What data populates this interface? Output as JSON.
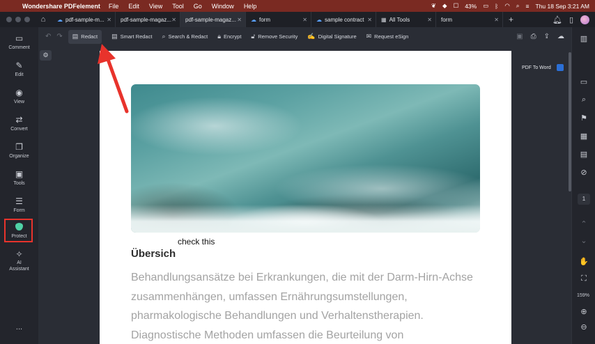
{
  "menubar": {
    "app_name": "Wondershare PDFelement",
    "items": [
      "File",
      "Edit",
      "View",
      "Tool",
      "Go",
      "Window",
      "Help"
    ],
    "battery": "43%",
    "clock": "Thu 18 Sep  3:21 AM"
  },
  "tabs": [
    {
      "label": "pdf-sample-m...",
      "cloud": true
    },
    {
      "label": "pdf-sample-magaz...",
      "cloud": false
    },
    {
      "label": "pdf-sample-magaz...",
      "cloud": false
    },
    {
      "label": "form",
      "cloud": true
    },
    {
      "label": "sample contract",
      "cloud": true
    },
    {
      "label": "All Tools",
      "cloud": false
    },
    {
      "label": "form",
      "cloud": false
    }
  ],
  "sidebar": {
    "items": [
      "Comment",
      "Edit",
      "View",
      "Convert",
      "Organize",
      "Tools",
      "Form",
      "Protect",
      "AI\nAssistant"
    ],
    "more": "..."
  },
  "toolbar": {
    "redact": "Redact",
    "smart_redact": "Smart Redact",
    "search_redact": "Search & Redact",
    "encrypt": "Encrypt",
    "remove_security": "Remove Security",
    "digital_signature": "Digital Signature",
    "request_esign": "Request eSign"
  },
  "document": {
    "annotation": "check this",
    "heading": "Übersich",
    "paragraph": "Behandlungsansätze bei Erkrankungen, die mit der Darm-Hirn-Achse zusammenhängen, umfassen Ernährungsumstellungen, pharmakologische Behandlungen und Verhaltenstherapien. Diagnostische Methoden umfassen die Beurteilung von"
  },
  "right_panel": {
    "pdf_to_word": "PDF To Word",
    "page_number": "1",
    "zoom": "159%"
  },
  "colors": {
    "highlight": "#e8332c",
    "protect_accent": "#4fd1a5"
  }
}
